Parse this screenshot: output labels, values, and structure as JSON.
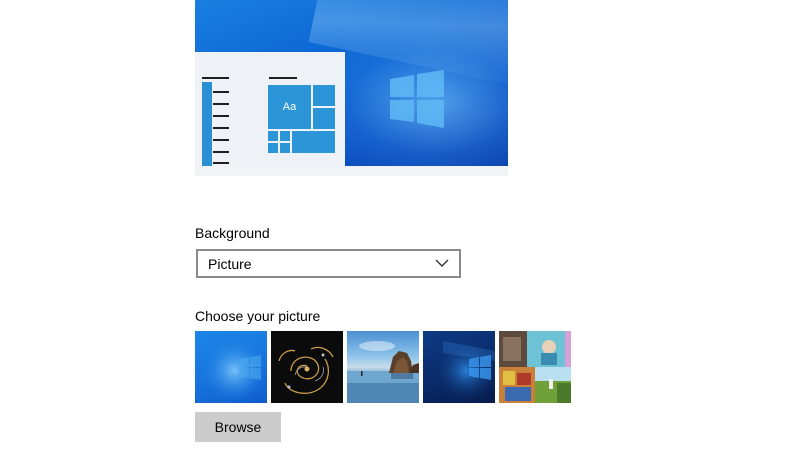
{
  "preview": {
    "tile_text": "Aa",
    "icon": "windows-logo-icon"
  },
  "background": {
    "label": "Background",
    "selected": "Picture",
    "dropdown_icon": "chevron-down-icon"
  },
  "choose_picture": {
    "label": "Choose your picture",
    "thumbnails": [
      "windows-light-wallpaper",
      "dark-swirl-wallpaper",
      "beach-rocks-wallpaper",
      "windows-dark-wallpaper",
      "collage-wallpaper"
    ]
  },
  "browse_button": {
    "label": "Browse"
  },
  "colors": {
    "accent": "#2b95d8",
    "dropdown_border": "#8a8a8a",
    "button_bg": "#cccccc"
  }
}
